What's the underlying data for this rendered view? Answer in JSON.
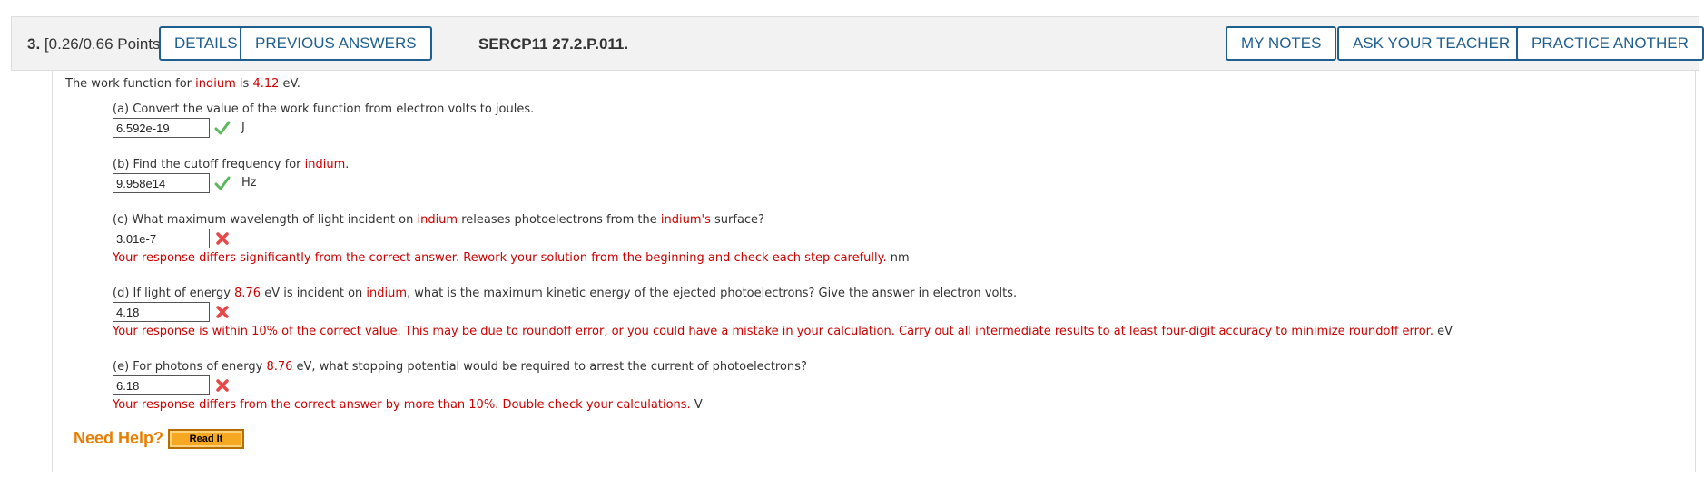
{
  "question": {
    "number": "3.",
    "points": "[0.26/0.66 Points]",
    "code": "SERCP11 27.2.P.011."
  },
  "buttons": {
    "details": "DETAILS",
    "previous_answers": "PREVIOUS ANSWERS",
    "my_notes": "MY NOTES",
    "ask_teacher": "ASK YOUR TEACHER",
    "practice_another": "PRACTICE ANOTHER"
  },
  "intro": {
    "t1": "The work function for ",
    "element": "indium",
    "t2": " is ",
    "value": "4.12",
    "t3": " eV."
  },
  "parts": {
    "a": {
      "question": "(a) Convert the value of the work function from electron volts to joules.",
      "answer": "6.592e-19",
      "status": "correct",
      "unit": "J"
    },
    "b": {
      "q1": "(b) Find the cutoff frequency for ",
      "element": "indium",
      "q2": ".",
      "answer": "9.958e14",
      "status": "correct",
      "unit": "Hz"
    },
    "c": {
      "q1": "(c) What maximum wavelength of light incident on ",
      "element": "indium",
      "q2": " releases photoelectrons from the ",
      "element2": "indium's",
      "q3": " surface?",
      "answer": "3.01e-7",
      "status": "incorrect",
      "feedback": "Your response differs significantly from the correct answer. Rework your solution from the beginning and check each step carefully.",
      "unit": "nm"
    },
    "d": {
      "q1": "(d) If light of energy ",
      "energy": "8.76",
      "q2": " eV is incident on ",
      "element": "indium",
      "q3": ", what is the maximum kinetic energy of the ejected photoelectrons? Give the answer in electron volts.",
      "answer": "4.18",
      "status": "incorrect",
      "feedback": "Your response is within 10% of the correct value. This may be due to roundoff error, or you could have a mistake in your calculation. Carry out all intermediate results to at least four-digit accuracy to minimize roundoff error.",
      "unit": "eV"
    },
    "e": {
      "q1": "(e) For photons of energy ",
      "energy": "8.76",
      "q2": " eV, what stopping potential would be required to arrest the current of photoelectrons?",
      "answer": "6.18",
      "status": "incorrect",
      "feedback": "Your response differs from the correct answer by more than 10%. Double check your calculations.",
      "unit": "V"
    }
  },
  "help": {
    "label": "Need Help?",
    "read_it": "Read It"
  },
  "colors": {
    "accent": "#1f5f8f",
    "highlight": "#cc0000",
    "correct": "#5cb85c",
    "incorrect": "#e8474a",
    "help": "#e87d00"
  }
}
